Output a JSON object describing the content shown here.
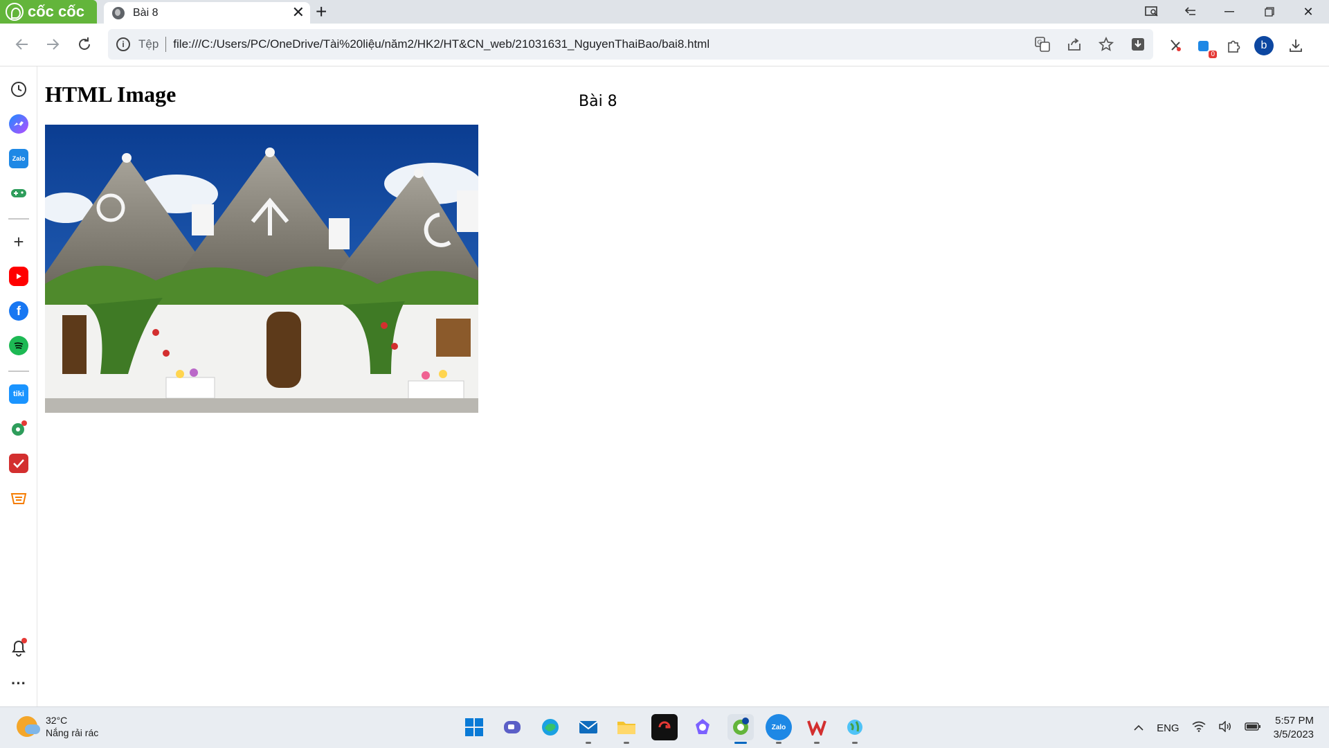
{
  "browser": {
    "brand": "cốc cốc",
    "tab": {
      "title": "Bài 8"
    },
    "address": {
      "scheme_label": "Tệp",
      "url": "file:///C:/Users/PC/OneDrive/Tài%20liệu/năm2/HK2/HT&CN_web/21031631_NguyenThaiBao/bai8.html"
    },
    "profile_initial": "b",
    "extension_badge": "0"
  },
  "sidebar": {
    "items": [
      "history-icon",
      "messenger-icon",
      "zalo-icon",
      "game-icon",
      "add-icon",
      "youtube-icon",
      "facebook-icon",
      "spotify-icon",
      "tiki-icon",
      "football-icon",
      "todoist-icon",
      "shop-icon",
      "bell-icon",
      "more-icon"
    ]
  },
  "page": {
    "heading": "HTML Image",
    "title_text": "Bài 8"
  },
  "taskbar": {
    "weather": {
      "temp": "32°C",
      "desc": "Nắng rải rác"
    },
    "apps": [
      "windows-start",
      "teams",
      "edge",
      "mail",
      "file-explorer",
      "garena",
      "copilot",
      "coccoc",
      "zalo",
      "wps",
      "globe-app"
    ],
    "language": "ENG",
    "time": "5:57 PM",
    "date": "3/5/2023"
  },
  "colors": {
    "brand_green": "#63b53b",
    "tab_bg": "#dfe3e8",
    "accent_blue": "#0067c0"
  }
}
